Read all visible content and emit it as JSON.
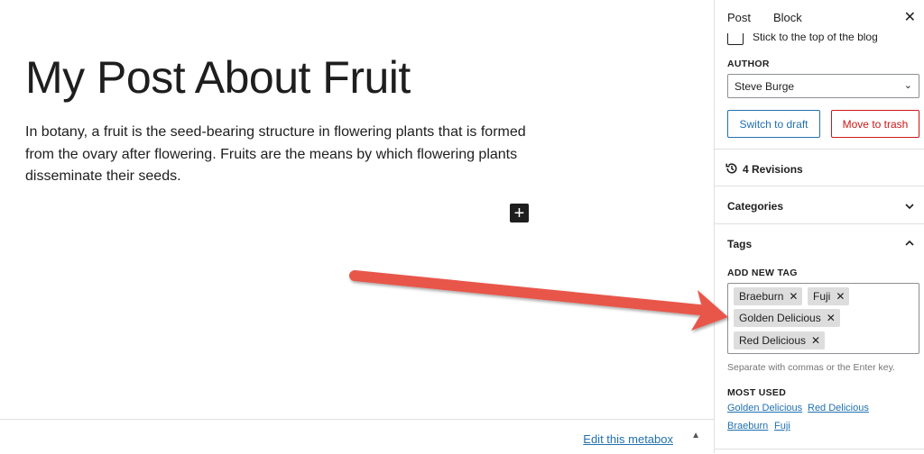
{
  "editor": {
    "title": "My Post About Fruit",
    "body": "In botany, a fruit is the seed-bearing structure in flowering plants that is formed from the ovary after flowering. Fruits are the means by which flowering plants disseminate their seeds.",
    "add_block_symbol": "+",
    "metabox_link": "Edit this metabox",
    "metabox_caret": "▲"
  },
  "sidebar": {
    "tabs": {
      "post": "Post",
      "block": "Block"
    },
    "close_symbol": "✕",
    "sticky_label": "Stick to the top of the blog",
    "author": {
      "label": "AUTHOR",
      "value": "Steve Burge",
      "caret": "⌄"
    },
    "buttons": {
      "switch_to_draft": "Switch to draft",
      "move_to_trash": "Move to trash"
    },
    "revisions": "4 Revisions",
    "categories": "Categories",
    "tags": {
      "title": "Tags",
      "add_new_label": "ADD NEW TAG",
      "selected": [
        "Braeburn",
        "Fuji",
        "Golden Delicious",
        "Red Delicious"
      ],
      "remove_symbol": "✕",
      "help": "Separate with commas or the Enter key.",
      "most_used_label": "MOST USED",
      "most_used": [
        "Golden Delicious",
        "Red Delicious",
        "Braeburn",
        "Fuji"
      ]
    }
  },
  "colors": {
    "link": "#2271b1",
    "danger": "#cc1818",
    "arrow": "#e8564a",
    "tag_bg": "#dddddd"
  },
  "icons": {
    "revisions": "history-icon",
    "chevron": "chevron-icon",
    "close": "close-icon",
    "add": "plus-icon"
  }
}
